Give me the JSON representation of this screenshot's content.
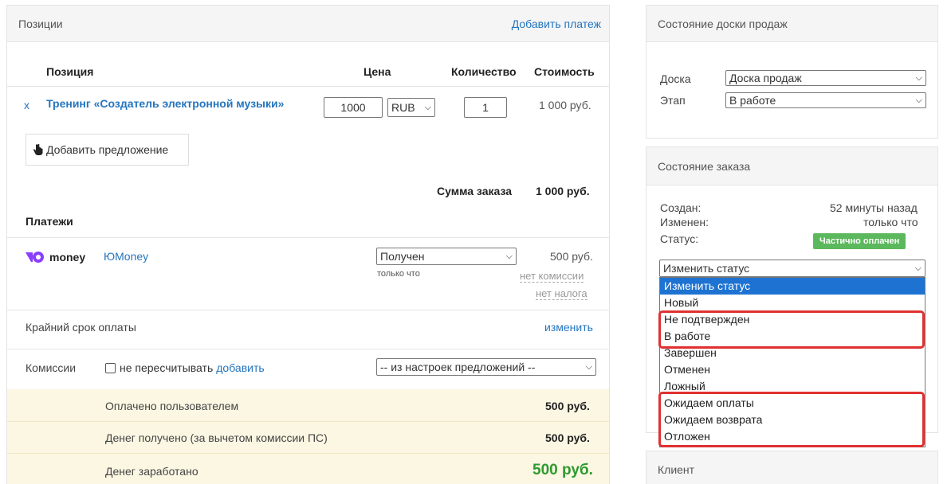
{
  "positions": {
    "title": "Позиции",
    "add_payment": "Добавить платеж",
    "headers": {
      "position": "Позиция",
      "price": "Цена",
      "qty": "Количество",
      "cost": "Стоимость"
    },
    "item": {
      "remove": "x",
      "name": "Тренинг «Создатель электронной музыки»",
      "price": "1000",
      "currency": "RUB",
      "qty": "1",
      "cost": "1 000 руб."
    },
    "add_offer": "Добавить предложение",
    "order_sum_label": "Сумма заказа",
    "order_sum_value": "1 000 руб."
  },
  "payments": {
    "title": "Платежи",
    "brand": "money",
    "provider": "ЮMoney",
    "status": "Получен",
    "status_time": "только что",
    "amount": "500 руб.",
    "no_commission": "нет комиссии",
    "no_tax": "нет налога"
  },
  "deadline": {
    "label": "Крайний срок оплаты",
    "change": "изменить"
  },
  "commissions": {
    "label": "Комиссии",
    "checkbox_label": "не пересчитывать",
    "add": "добавить",
    "select": "-- из настроек предложений --"
  },
  "totals": [
    {
      "label": "Оплачено пользователем",
      "value": "500 руб."
    },
    {
      "label": "Денег получено (за вычетом комиссии ПС)",
      "value": "500 руб."
    },
    {
      "label": "Денег заработано",
      "value": "500 руб."
    }
  ],
  "board": {
    "title": "Состояние доски продаж",
    "board_label": "Доска",
    "board_value": "Доска продаж",
    "stage_label": "Этап",
    "stage_value": "В работе"
  },
  "order": {
    "title": "Состояние заказа",
    "created_label": "Создан:",
    "created_value": "52 минуты назад",
    "changed_label": "Изменен:",
    "changed_value": "только что",
    "status_label": "Статус:",
    "status_badge": "Частично оплачен",
    "change_status": "Изменить статус",
    "options": [
      "Изменить статус",
      "Новый",
      "Не подтвержден",
      "В работе",
      "Завершен",
      "Отменен",
      "Ложный",
      "Ожидаем оплаты",
      "Ожидаем возврата",
      "Отложен"
    ]
  },
  "client": {
    "title": "Клиент"
  },
  "colors": {
    "link": "#2475bf",
    "badge": "#5cb85c",
    "highlight": "#e03030",
    "cream": "#fbf7e3",
    "earned": "#2e9a2e"
  }
}
